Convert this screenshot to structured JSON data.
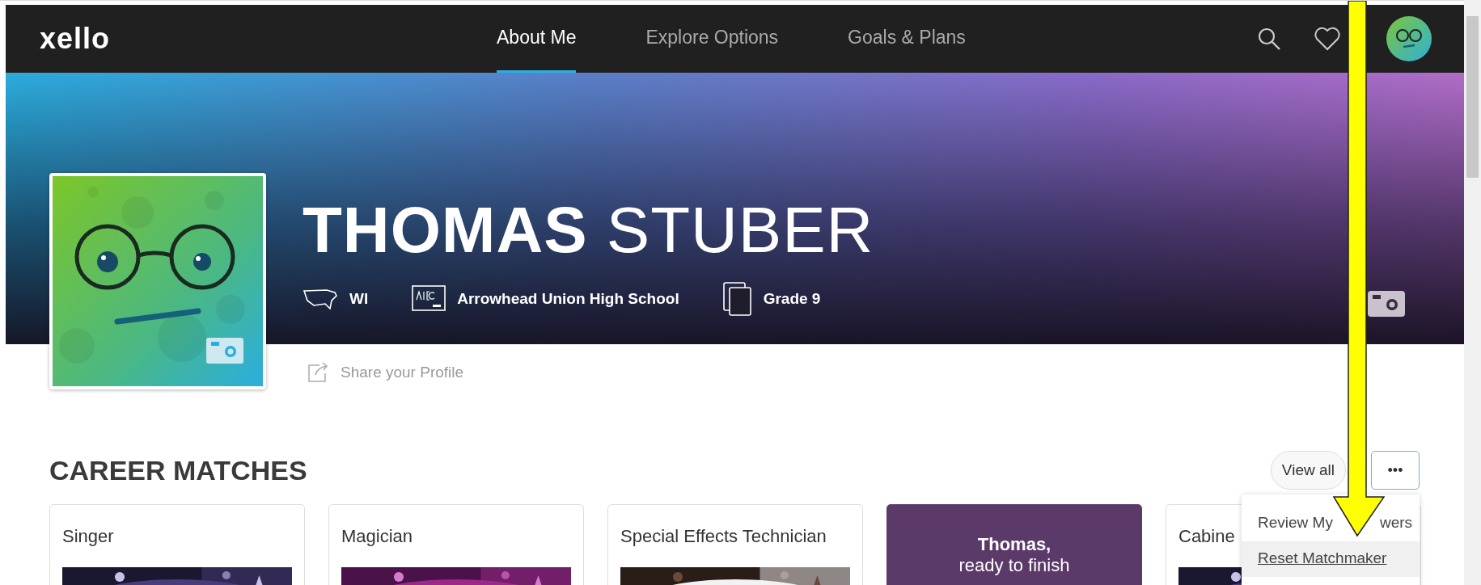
{
  "nav": {
    "logo": "xello",
    "tabs": [
      {
        "label": "About Me",
        "selected": true
      },
      {
        "label": "Explore Options",
        "selected": false
      },
      {
        "label": "Goals & Plans",
        "selected": false
      }
    ]
  },
  "profile": {
    "first_name": "THOMAS",
    "last_name": "STUBER",
    "info": [
      {
        "kind": "state",
        "text": "WI"
      },
      {
        "kind": "school",
        "text": "Arrowhead Union High School"
      },
      {
        "kind": "grade",
        "text": "Grade 9"
      }
    ],
    "share": "Share your Profile"
  },
  "career_matches": {
    "title": "CAREER MATCHES",
    "view_all": "View all",
    "more": "•••",
    "menu": [
      {
        "label": "Review My",
        "label_end": "wers",
        "selected": false
      },
      {
        "label": "Reset Matchmaker",
        "selected": true
      }
    ],
    "cards": [
      {
        "kind": "career",
        "title": "Singer"
      },
      {
        "kind": "career",
        "title": "Magician"
      },
      {
        "kind": "career",
        "title": "Special Effects Technician"
      },
      {
        "kind": "prompt",
        "title": "Thomas,",
        "subtitle": "ready to finish"
      },
      {
        "kind": "career",
        "title": "Cabine"
      }
    ]
  }
}
